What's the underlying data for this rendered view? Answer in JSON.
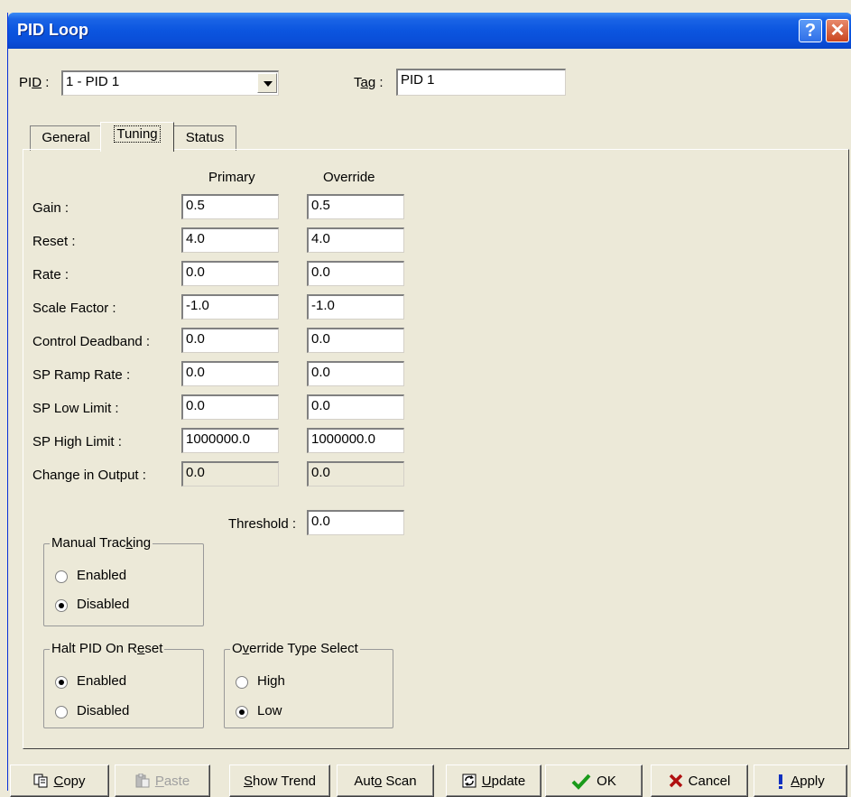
{
  "window": {
    "title": "PID Loop",
    "help_glyph": "?",
    "close_glyph": "✕"
  },
  "top": {
    "pid_label_pre": "PI",
    "pid_label_u": "D",
    "pid_label_post": " :",
    "pid_value": "1 - PID 1",
    "tag_label_pre": "T",
    "tag_label_u": "a",
    "tag_label_post": "g :",
    "tag_value": "PID 1"
  },
  "tabs": [
    {
      "label": "General"
    },
    {
      "label": "Tuning",
      "active": true
    },
    {
      "label": "Status"
    }
  ],
  "tuning": {
    "col_primary": "Primary",
    "col_override": "Override",
    "rows": [
      {
        "label": "Gain :",
        "primary": "0.5",
        "override": "0.5"
      },
      {
        "label": "Reset :",
        "primary": "4.0",
        "override": "4.0"
      },
      {
        "label": "Rate :",
        "primary": "0.0",
        "override": "0.0"
      },
      {
        "label": "Scale Factor :",
        "primary": "-1.0",
        "override": "-1.0"
      },
      {
        "label": "Control Deadband :",
        "primary": "0.0",
        "override": "0.0"
      },
      {
        "label": "SP Ramp Rate :",
        "primary": "0.0",
        "override": "0.0"
      },
      {
        "label": "SP Low Limit :",
        "primary": "0.0",
        "override": "0.0"
      },
      {
        "label": "SP High Limit :",
        "primary": "1000000.0",
        "override": "1000000.0"
      },
      {
        "label": "Change in Output :",
        "primary": "0.0",
        "override": "0.0"
      }
    ],
    "threshold_label": "Threshold :",
    "threshold_value": "0.0"
  },
  "manual_tracking": {
    "title_pre": "Manual Trac",
    "title_u": "k",
    "title_post": "ing",
    "options": [
      {
        "label": "Enabled",
        "selected": false
      },
      {
        "label": "Disabled",
        "selected": true
      }
    ]
  },
  "halt_pid": {
    "title_pre": "Halt PID On R",
    "title_u": "e",
    "title_post": "set",
    "options": [
      {
        "label": "Enabled",
        "selected": true
      },
      {
        "label": "Disabled",
        "selected": false
      }
    ]
  },
  "override_type": {
    "title_pre": "O",
    "title_u": "v",
    "title_post": "erride Type Select",
    "options": [
      {
        "label": "High",
        "selected": false
      },
      {
        "label": "Low",
        "selected": true
      }
    ]
  },
  "buttons": {
    "copy": {
      "u": "C",
      "rest": "opy"
    },
    "paste": {
      "u": "P",
      "rest": "aste"
    },
    "show_trend": {
      "u": "S",
      "rest": "how Trend"
    },
    "auto_scan": {
      "pre": "Aut",
      "u": "o",
      "rest": " Scan"
    },
    "update": {
      "u": "U",
      "rest": "pdate"
    },
    "ok": "OK",
    "cancel": "Cancel",
    "apply": {
      "u": "A",
      "rest": "pply"
    }
  },
  "colors": {
    "titlebar": "#0a54e3",
    "dialog_bg": "#ece9d8",
    "ok_check": "#1a9a1a",
    "cancel_x": "#b01010",
    "apply_bang": "#1030c0"
  }
}
